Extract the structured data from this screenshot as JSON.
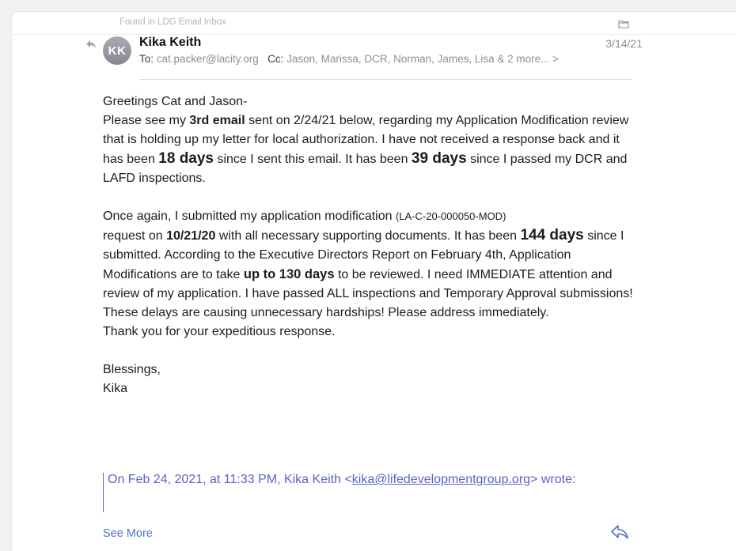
{
  "mailbox": {
    "label": "Found in LDG Email Inbox",
    "folder_icon": "folder-icon"
  },
  "message": {
    "avatar_initials": "KK",
    "sender": "Kika Keith",
    "date": "3/14/21",
    "to_label": "To:",
    "to": "cat.packer@lacity.org",
    "cc_label": "Cc:",
    "cc": "Jason, Marissa, DCR, Norman, James, Lisa & 2 more... >",
    "replied_indicator_icon": "reply-arrow-icon"
  },
  "body": {
    "greeting": "Greetings Cat and Jason-",
    "p1": {
      "t1": "Please see my ",
      "b1": "3rd email",
      "t2": " sent on 2/24/21 below, regarding my Application Modification review that is holding up my letter for local authorization. I have not received a response back and it has been ",
      "b2": "18 days",
      "t3": " since I sent this email. It has been ",
      "b3": "39 days",
      "t4": " since I passed my DCR and LAFD inspections."
    },
    "p2": {
      "t1": "Once again, I submitted my application modification ",
      "small": "(LA-C-20-000050-MOD)",
      "t2": " request on ",
      "b1": "10/21/20",
      "t3": " with all necessary supporting documents. It has been ",
      "b2": "144 days",
      "t4": " since I submitted. According to the Executive Directors Report on February 4th, Application Modifications are to take ",
      "b3": "up to 130 days",
      "t5": " to be reviewed. I need IMMEDIATE attention and review of my application. I have passed ALL inspections and Temporary Approval submissions! These delays are causing unnecessary hardships! Please address immediately."
    },
    "thanks": "Thank you for your expeditious response.",
    "signoff": "Blessings,",
    "signature": "Kika"
  },
  "quote": {
    "prefix": "On Feb 24, 2021, at 11:33 PM, Kika Keith <",
    "email": "kika@lifedevelopmentgroup.org",
    "suffix": "> wrote:"
  },
  "actions": {
    "see_more": "See More",
    "reply_icon": "reply-icon"
  }
}
